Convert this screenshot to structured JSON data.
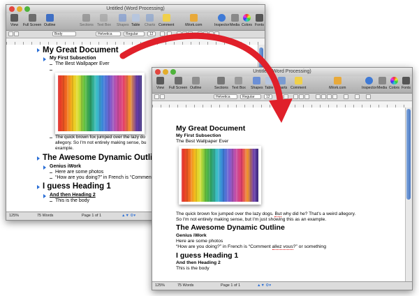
{
  "windows": [
    {
      "title": "Untitled (Word Processing)",
      "toolbar": [
        "View",
        "Full Screen",
        "Outline",
        "Sections",
        "Text Box",
        "Shapes",
        "Table",
        "Charts",
        "Comment",
        "iWork.com",
        "Inspector",
        "Media",
        "Colors",
        "Fonts"
      ],
      "format": {
        "style": "Body",
        "font": "Helvetica",
        "typeface": "Regular",
        "size": "12"
      },
      "status": {
        "zoom": "125%",
        "words": "75 Words",
        "page": "Page 1 of 1"
      },
      "outline": {
        "title": "My Great Document",
        "sub1": "My First Subsection",
        "item1": "The Best Wallpaper Ever",
        "para": [
          "The quick brown fox jumped over the lazy do",
          "allegory.  So I'm not entirely making sense, bu",
          "example."
        ],
        "h2": "The Awesome Dynamic Outline",
        "sub2": "Genius iWork",
        "item2": "Here are some photos",
        "item3": "“How are you doing?” in French is “Comment",
        "h3": "I guess Heading 1",
        "sub3": "And then Heading 2",
        "item4": "This is the body"
      }
    },
    {
      "title": "Untitled (Word Processing)",
      "toolbar": [
        "View",
        "Full Screen",
        "Outline",
        "Sections",
        "Text Box",
        "Shapes",
        "Table",
        "Charts",
        "Comment",
        "iWork.com",
        "Inspector",
        "Media",
        "Colors",
        "Fonts"
      ],
      "format": {
        "style": "",
        "font": "Helvetica",
        "typeface": "Regular",
        "size": "12"
      },
      "status": {
        "zoom": "125%",
        "words": "75 Words",
        "page": "Page 1 of 1"
      },
      "doc": {
        "title": "My Great Document",
        "sub1": "My First Subsection",
        "line1": "The Best Wallpaper Ever",
        "para1_a": "The quick brown fox jumped over the lazy dogs.  ",
        "para1_b": "But",
        "para1_c": " why did he?  That's a weird allegory.",
        "para2": "So I'm not entirely making sense, but I'm just showing this as an example.",
        "h2": "The Awesome Dynamic Outline",
        "sub2": "Genius iWork",
        "line2": "Here are some photos",
        "line3_a": "“How are you doing?” in French is “Comment ",
        "line3_b": "allez vous",
        "line3_c": "?” or something",
        "h3": "I guess Heading 1",
        "sub3": "And then Heading 2",
        "line4": "This is the body"
      }
    }
  ],
  "colors": {
    "arrow": "#e0202a",
    "outline_triangle": "#2b6fd6",
    "scroll": "#4b78c2"
  }
}
